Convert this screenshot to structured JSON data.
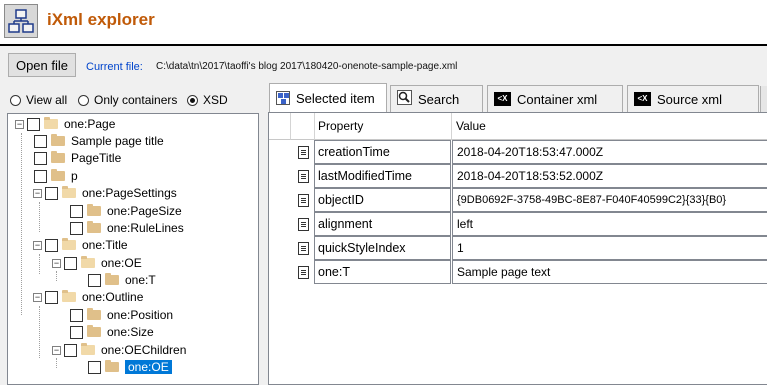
{
  "app": {
    "title": "iXml explorer",
    "icon": "app-hierarchy-icon"
  },
  "file": {
    "open_label": "Open file",
    "current_label": "Current file:",
    "path": "C:\\data\\tn\\2017\\taoffi's blog 2017\\180420-onenote-sample-page.xml"
  },
  "view_modes": [
    {
      "label": "View all",
      "selected": false
    },
    {
      "label": "Only containers",
      "selected": false
    },
    {
      "label": "XSD",
      "selected": true
    }
  ],
  "tree": [
    {
      "label": "one:Page",
      "level": 0,
      "toggle": "-",
      "open": true
    },
    {
      "label": "Sample page title",
      "level": 1
    },
    {
      "label": "PageTitle",
      "level": 1
    },
    {
      "label": "p",
      "level": 1
    },
    {
      "label": "one:PageSettings",
      "level": 1,
      "toggle": "-",
      "open": true
    },
    {
      "label": "one:PageSize",
      "level": 2
    },
    {
      "label": "one:RuleLines",
      "level": 2
    },
    {
      "label": "one:Title",
      "level": 1,
      "toggle": "-",
      "open": true
    },
    {
      "label": "one:OE",
      "level": 2,
      "toggle": "-",
      "open": true
    },
    {
      "label": "one:T",
      "level": 3
    },
    {
      "label": "one:Outline",
      "level": 1,
      "toggle": "-",
      "open": true
    },
    {
      "label": "one:Position",
      "level": 2
    },
    {
      "label": "one:Size",
      "level": 2
    },
    {
      "label": "one:OEChildren",
      "level": 2,
      "toggle": "-",
      "open": true
    },
    {
      "label": "one:OE",
      "level": 3,
      "selected": true
    }
  ],
  "tabs": [
    {
      "label": "Selected item",
      "icon": "grid-icon",
      "active": true
    },
    {
      "label": "Search",
      "icon": "search-icon",
      "active": false
    },
    {
      "label": "Container xml",
      "icon": "xml-code-icon",
      "active": false
    },
    {
      "label": "Source xml",
      "icon": "xml-code-icon",
      "active": false
    }
  ],
  "grid": {
    "columns": [
      "Property",
      "Value"
    ],
    "rows": [
      {
        "property": "creationTime",
        "value": "2018-04-20T18:53:47.000Z"
      },
      {
        "property": "lastModifiedTime",
        "value": "2018-04-20T18:53:52.000Z"
      },
      {
        "property": "objectID",
        "value": "{9DB0692F-3758-49BC-8E87-F040F40599C2}{33}{B0}"
      },
      {
        "property": "alignment",
        "value": "left"
      },
      {
        "property": "quickStyleIndex",
        "value": "1"
      },
      {
        "property": "one:T",
        "value": "Sample page text"
      }
    ]
  }
}
